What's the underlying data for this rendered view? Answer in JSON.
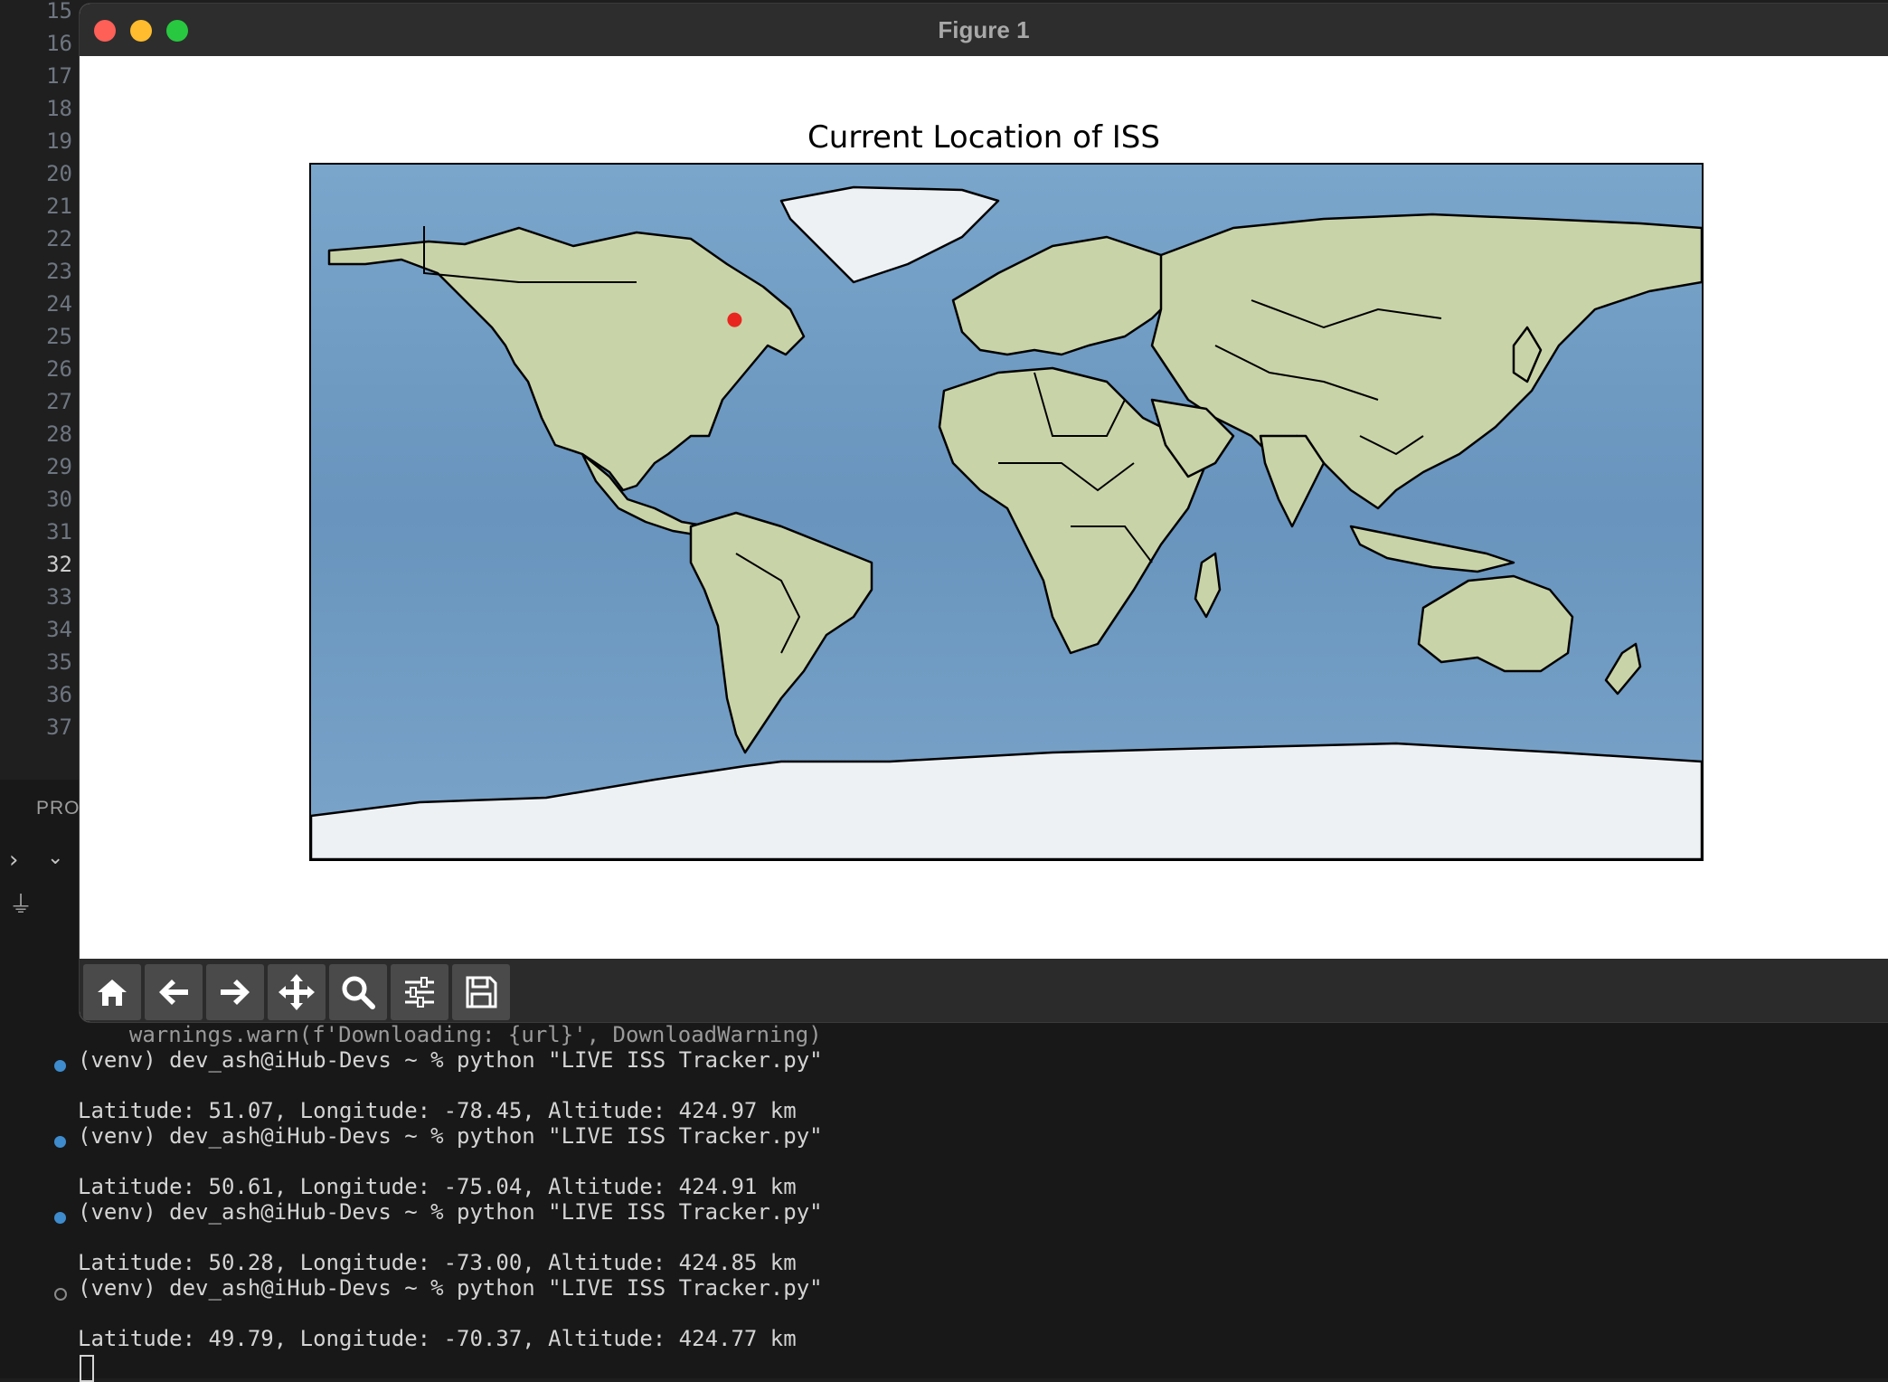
{
  "editor": {
    "line_numbers": [
      "15",
      "16",
      "17",
      "18",
      "19",
      "20",
      "21",
      "22",
      "23",
      "24",
      "25",
      "26",
      "27",
      "28",
      "29",
      "30",
      "31",
      "32",
      "33",
      "34",
      "35",
      "36",
      "37"
    ],
    "active_line": "32"
  },
  "panel": {
    "tab_label": "PRO"
  },
  "window": {
    "title": "Figure 1"
  },
  "figure": {
    "title": "Current Location of ISS",
    "iss_marker": {
      "latitude": 49.79,
      "longitude": -70.37,
      "color": "#e8261f"
    },
    "map_extent": {
      "lon": [
        -180,
        180
      ],
      "lat": [
        -90,
        90
      ]
    }
  },
  "toolbar": {
    "buttons": [
      "home-icon",
      "back-arrow-icon",
      "forward-arrow-icon",
      "pan-icon",
      "zoom-icon",
      "configure-subplots-icon",
      "save-icon"
    ]
  },
  "terminal": {
    "partial_line": "  warnings.warn(f'Downloading: {url}', DownloadWarning)",
    "prompts": [
      {
        "command": "(venv) dev_ash@iHub-Devs ~ % python \"LIVE ISS Tracker.py\"",
        "output": "Latitude: 51.07, Longitude: -78.45, Altitude: 424.97 km",
        "status": "blue"
      },
      {
        "command": "(venv) dev_ash@iHub-Devs ~ % python \"LIVE ISS Tracker.py\"",
        "output": "Latitude: 50.61, Longitude: -75.04, Altitude: 424.91 km",
        "status": "blue"
      },
      {
        "command": "(venv) dev_ash@iHub-Devs ~ % python \"LIVE ISS Tracker.py\"",
        "output": "Latitude: 50.28, Longitude: -73.00, Altitude: 424.85 km",
        "status": "blue"
      },
      {
        "command": "(venv) dev_ash@iHub-Devs ~ % python \"LIVE ISS Tracker.py\"",
        "output": "Latitude: 49.79, Longitude: -70.37, Altitude: 424.77 km",
        "status": "hollow"
      }
    ]
  }
}
